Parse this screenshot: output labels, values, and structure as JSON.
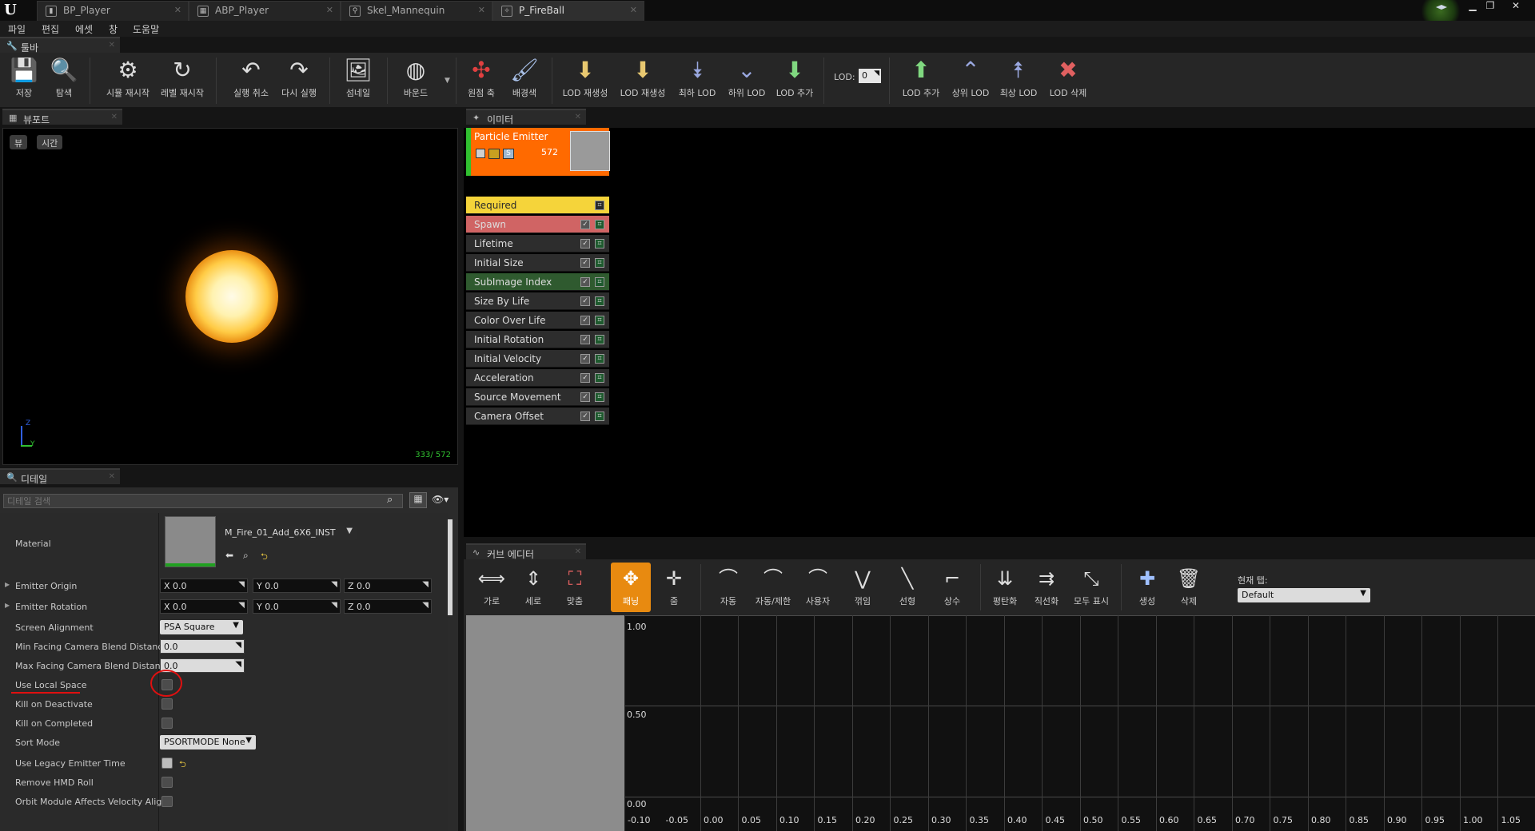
{
  "tabs": [
    {
      "label": "BP_Player",
      "icon": "blueprint-icon"
    },
    {
      "label": "ABP_Player",
      "icon": "anim-blueprint-icon"
    },
    {
      "label": "Skel_Mannequin",
      "icon": "skeleton-icon"
    },
    {
      "label": "P_FireBall",
      "icon": "particle-icon"
    }
  ],
  "menu": [
    "파일",
    "편집",
    "에셋",
    "창",
    "도움말"
  ],
  "toolbar": {
    "panel_title": "툴바",
    "buttons": [
      "저장",
      "탐색",
      "시뮬 재시작",
      "레벨 재시작",
      "실행 취소",
      "다시 실행",
      "섬네일",
      "바운드",
      "원점 축",
      "배경색",
      "LOD 재생성",
      "LOD 재생성",
      "최하 LOD",
      "하위 LOD",
      "LOD 추가",
      "LOD 추가",
      "상위 LOD",
      "최상 LOD",
      "LOD 삭제"
    ],
    "lod_label": "LOD:",
    "lod_value": "0"
  },
  "viewport": {
    "panel_title": "뷰포트",
    "view_button": "뷰",
    "time_button": "시간",
    "particle_count": "333/ 572",
    "axis_z": "Z",
    "axis_y": "Y"
  },
  "details": {
    "panel_title": "디테일",
    "search_placeholder": "디테일 검색",
    "material_label": "Material",
    "material_value": "M_Fire_01_Add_6X6_INST",
    "emitter_origin": {
      "label": "Emitter Origin",
      "x": "X 0.0",
      "y": "Y 0.0",
      "z": "Z 0.0"
    },
    "emitter_rotation": {
      "label": "Emitter Rotation",
      "x": "X 0.0",
      "y": "Y 0.0",
      "z": "Z 0.0"
    },
    "screen_alignment": {
      "label": "Screen Alignment",
      "value": "PSA Square"
    },
    "min_facing": {
      "label": "Min Facing Camera Blend Distance",
      "value": "0.0"
    },
    "max_facing": {
      "label": "Max Facing Camera Blend Distance",
      "value": "0.0"
    },
    "use_local_space": "Use Local Space",
    "kill_on_deactivate": "Kill on Deactivate",
    "kill_on_completed": "Kill on Completed",
    "sort_mode": {
      "label": "Sort Mode",
      "value": "PSORTMODE None"
    },
    "use_legacy_emitter_time": "Use Legacy Emitter Time",
    "remove_hmd_roll": "Remove HMD Roll",
    "orbit_module": "Orbit Module Affects Velocity Align"
  },
  "emitter": {
    "panel_title": "이미터",
    "name": "Particle Emitter",
    "count": "572",
    "modules": [
      "Required",
      "Spawn",
      "Lifetime",
      "Initial Size",
      "SubImage Index",
      "Size By Life",
      "Color Over Life",
      "Initial Rotation",
      "Initial Velocity",
      "Acceleration",
      "Source Movement",
      "Camera Offset"
    ]
  },
  "curve_editor": {
    "panel_title": "커브 에디터",
    "buttons": [
      "가로",
      "세로",
      "맞춤",
      "패닝",
      "줌",
      "자동",
      "자동/제한",
      "사용자",
      "꺾임",
      "선형",
      "상수",
      "평탄화",
      "직선화",
      "모두 표시",
      "생성",
      "삭제"
    ],
    "current_tab_label": "현재 탭:",
    "current_tab_value": "Default",
    "y_labels": [
      "1.00",
      "0.50",
      "0.00"
    ],
    "x_labels": [
      "-0.10",
      "-0.05",
      "0.00",
      "0.05",
      "0.10",
      "0.15",
      "0.20",
      "0.25",
      "0.30",
      "0.35",
      "0.40",
      "0.45",
      "0.50",
      "0.55",
      "0.60",
      "0.65",
      "0.70",
      "0.75",
      "0.80",
      "0.85",
      "0.90",
      "0.95",
      "1.00",
      "1.05"
    ]
  },
  "colors": {
    "emitter_orange": "#ff6a00",
    "required_yellow": "#f5d43a",
    "spawn_red": "#d06464",
    "subimage_green": "#2f5a2f",
    "annotation_red": "#e01010"
  }
}
